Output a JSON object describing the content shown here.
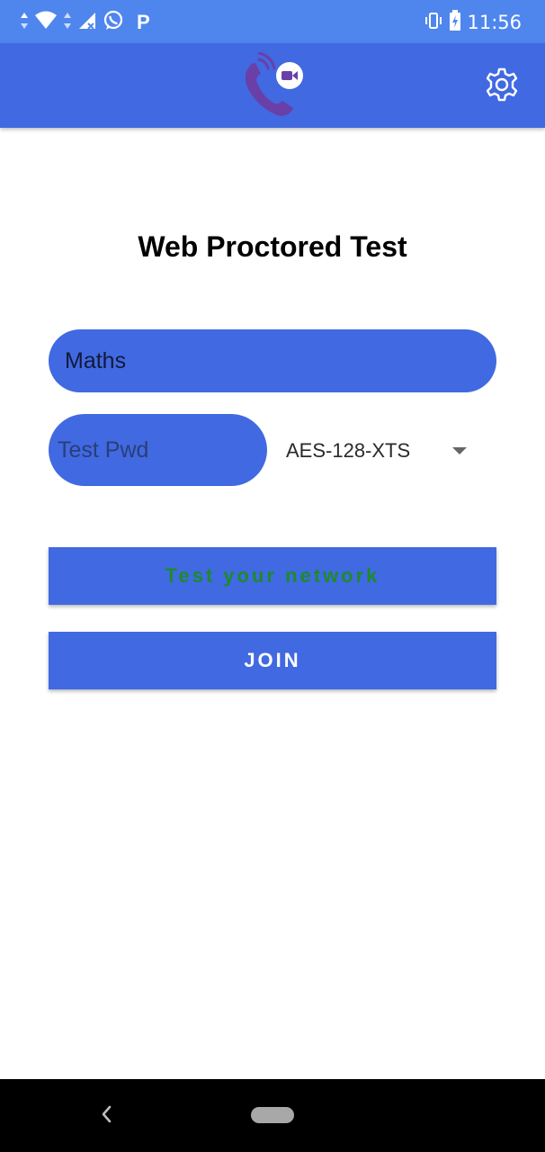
{
  "status_bar": {
    "time": "11:56",
    "icons_left": [
      "data-arrows-icon",
      "wifi-icon",
      "signal-icon",
      "whatsapp-icon",
      "p-app-icon"
    ],
    "p_badge": "P",
    "icons_right": [
      "vibrate-icon",
      "battery-icon"
    ]
  },
  "app_bar": {
    "logo_icon": "video-call-logo-icon",
    "settings_icon": "gear-icon"
  },
  "main": {
    "title": "Web Proctored Test",
    "subject_value": "Maths",
    "password_placeholder": "Test Pwd",
    "password_value": "",
    "encryption_selected": "AES-128-XTS",
    "test_network_label": "Test your network",
    "join_label": "JOIN"
  },
  "nav_bar": {
    "back_icon": "back-chevron-icon",
    "home_icon": "home-pill-icon"
  },
  "colors": {
    "status_bar": "#4f86ee",
    "primary": "#4169e1",
    "network_text": "#1e8a2e",
    "join_text": "#ffffff",
    "nav_bar": "#000000"
  }
}
